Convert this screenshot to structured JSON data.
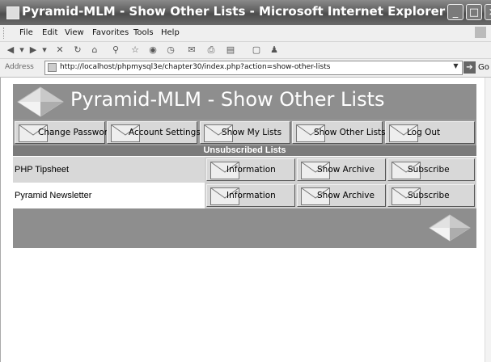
{
  "window": {
    "title": "Pyramid-MLM - Show Other Lists - Microsoft Internet Explorer",
    "controls": {
      "minimize": "_",
      "maximize": "□",
      "close": "×"
    }
  },
  "menu": [
    "File",
    "Edit",
    "View",
    "Favorites",
    "Tools",
    "Help"
  ],
  "toolbar": {
    "icons": [
      "back-icon",
      "forward-icon",
      "stop-icon",
      "refresh-icon",
      "home-icon",
      "search-icon",
      "favorites-icon",
      "media-icon",
      "history-icon",
      "mail-icon",
      "print-icon",
      "edit-icon",
      "discuss-icon",
      "messenger-icon"
    ]
  },
  "address": {
    "label": "Address",
    "url": "http://localhost/phpmysql3e/chapter30/index.php?action=show-other-lists",
    "go_label": "Go"
  },
  "page": {
    "header_title": "Pyramid-MLM - Show Other Lists",
    "nav_buttons": [
      {
        "label": "Change Password"
      },
      {
        "label": "Account Settings"
      },
      {
        "label": "Show My Lists"
      },
      {
        "label": "Show Other Lists"
      },
      {
        "label": "Log Out"
      }
    ],
    "section_title": "Unsubscribed Lists",
    "lists": [
      {
        "name": "PHP Tipsheet",
        "buttons": [
          "Information",
          "Show Archive",
          "Subscribe"
        ]
      },
      {
        "name": "Pyramid Newsletter",
        "buttons": [
          "Information",
          "Show Archive",
          "Subscribe"
        ]
      }
    ]
  },
  "colors": {
    "header_bg": "#8e8e8e",
    "section_bg": "#7b7b7b",
    "button_bg": "#d8d8d8",
    "row_alt_bg": "#d0d0d0"
  }
}
